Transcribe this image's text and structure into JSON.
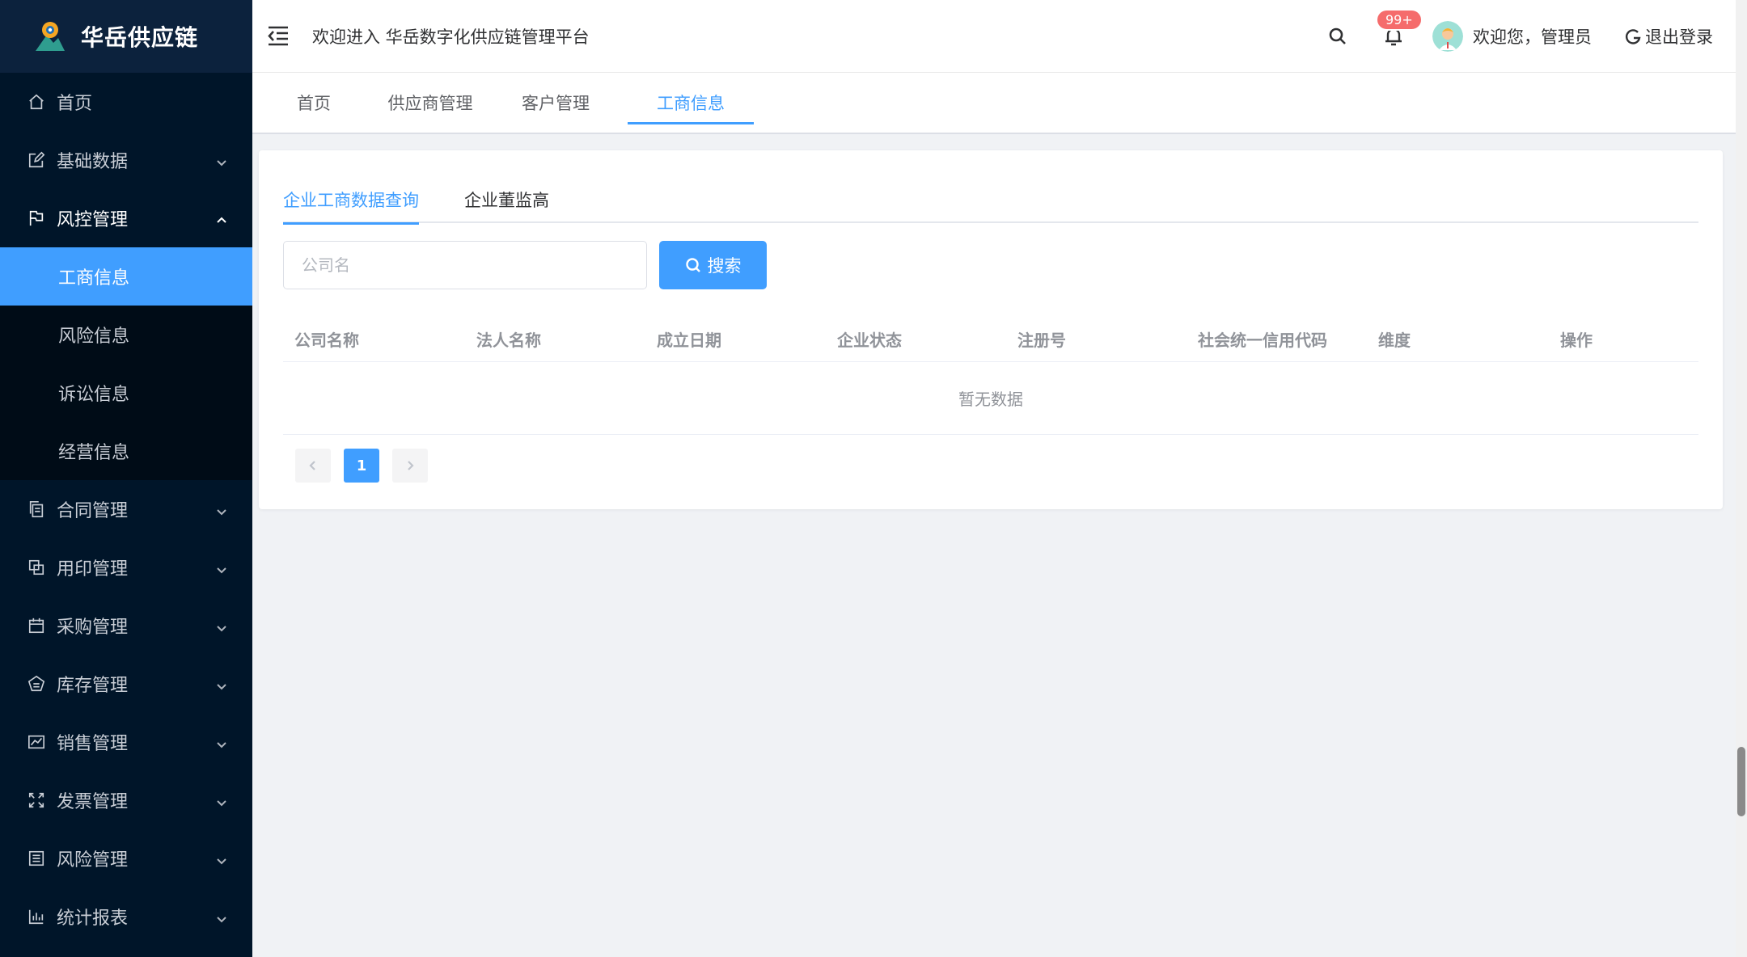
{
  "brand": {
    "name": "华岳供应链"
  },
  "sidebar": {
    "items": [
      {
        "label": "首页",
        "icon": "home-icon",
        "expandable": false
      },
      {
        "label": "基础数据",
        "icon": "edit-icon",
        "expandable": true
      },
      {
        "label": "风控管理",
        "icon": "flag-icon",
        "expandable": true,
        "open": true
      },
      {
        "label": "合同管理",
        "icon": "document-copy-icon",
        "expandable": true
      },
      {
        "label": "用印管理",
        "icon": "stamp-copy-icon",
        "expandable": true
      },
      {
        "label": "采购管理",
        "icon": "calendar-icon",
        "expandable": true
      },
      {
        "label": "库存管理",
        "icon": "warehouse-icon",
        "expandable": true
      },
      {
        "label": "销售管理",
        "icon": "trend-chart-icon",
        "expandable": true
      },
      {
        "label": "发票管理",
        "icon": "full-screen-icon",
        "expandable": true
      },
      {
        "label": "风险管理",
        "icon": "list-icon",
        "expandable": true
      },
      {
        "label": "统计报表",
        "icon": "bar-chart-icon",
        "expandable": true
      }
    ],
    "submenu": [
      {
        "label": "工商信息",
        "active": true
      },
      {
        "label": "风险信息",
        "active": false
      },
      {
        "label": "诉讼信息",
        "active": false
      },
      {
        "label": "经营信息",
        "active": false
      }
    ]
  },
  "header": {
    "title": "欢迎进入 华岳数字化供应链管理平台",
    "notification_badge": "99+",
    "user_greeting": "欢迎您，管理员",
    "logout_label": "退出登录"
  },
  "tags": [
    {
      "label": "首页",
      "active": false
    },
    {
      "label": "供应商管理",
      "active": false
    },
    {
      "label": "客户管理",
      "active": false
    },
    {
      "label": "工商信息",
      "active": true
    }
  ],
  "main": {
    "tabs": [
      {
        "label": "企业工商数据查询",
        "active": true
      },
      {
        "label": "企业董监高",
        "active": false
      }
    ],
    "search": {
      "placeholder": "公司名",
      "value": "",
      "button_label": "搜索"
    },
    "table": {
      "columns": [
        "公司名称",
        "法人名称",
        "成立日期",
        "企业状态",
        "注册号",
        "社会统一信用代码",
        "维度",
        "操作"
      ],
      "rows": [],
      "empty_text": "暂无数据"
    },
    "pagination": {
      "current_page": "1"
    }
  },
  "colors": {
    "sidebar_bg": "#001529",
    "sidebar_active": "#409eff",
    "accent": "#409eff",
    "badge": "#f56c6c",
    "page_bg": "#f0f2f5"
  }
}
